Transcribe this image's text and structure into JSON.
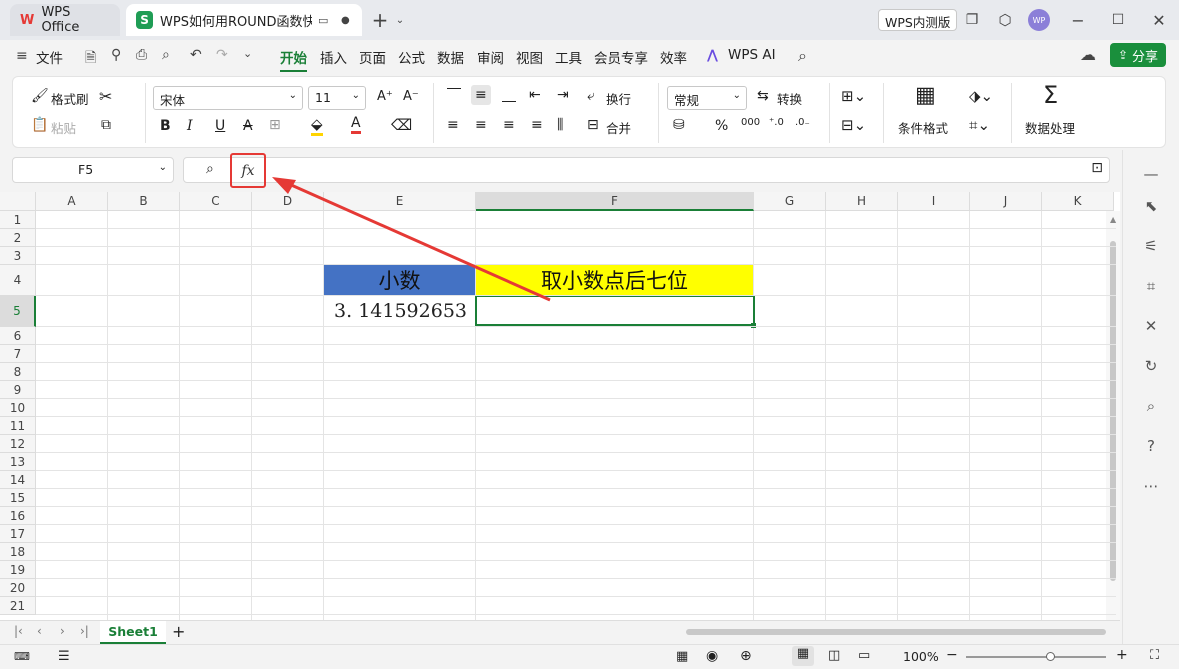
{
  "tabs": {
    "home_tab": "WPS Office",
    "doc_tab": "WPS如何用ROUND函数快速"
  },
  "titlebar": {
    "edition_badge": "WPS内测版",
    "avatar_text": "WP"
  },
  "menu": {
    "file": "文件",
    "items": [
      "开始",
      "插入",
      "页面",
      "公式",
      "数据",
      "审阅",
      "视图",
      "工具",
      "会员专享",
      "效率"
    ],
    "ai": "WPS AI",
    "share": "分享"
  },
  "ribbon": {
    "format_painter": "格式刷",
    "paste": "粘贴",
    "font_name": "宋体",
    "font_size": "11",
    "wrap": "换行",
    "merge": "合并",
    "number_format": "常规",
    "convert": "转换",
    "cond_format": "条件格式",
    "data_process": "数据处理",
    "bold": "B",
    "italic": "I",
    "underline": "U",
    "strike": "A",
    "percent": "%"
  },
  "formula_bar": {
    "name_box": "F5",
    "fx_label": "fx"
  },
  "grid": {
    "columns": [
      "A",
      "B",
      "C",
      "D",
      "E",
      "F",
      "G",
      "H",
      "I",
      "J",
      "K"
    ],
    "rows": [
      "1",
      "2",
      "3",
      "4",
      "5",
      "6",
      "7",
      "8",
      "9",
      "10",
      "11",
      "12",
      "13",
      "14",
      "15",
      "16",
      "17",
      "18",
      "19",
      "20",
      "21"
    ],
    "cells": {
      "E4": "小数",
      "F4": "取小数点后七位",
      "E5": "3. 141592653",
      "F5": ""
    },
    "selected_cell": "F5",
    "colors": {
      "E4_fill": "#4472c4",
      "F4_fill": "#ffff00",
      "selection": "#1a7f37",
      "annotation": "#e53935"
    }
  },
  "sheets": {
    "tabs": [
      "Sheet1"
    ]
  },
  "status": {
    "zoom": "100%"
  }
}
